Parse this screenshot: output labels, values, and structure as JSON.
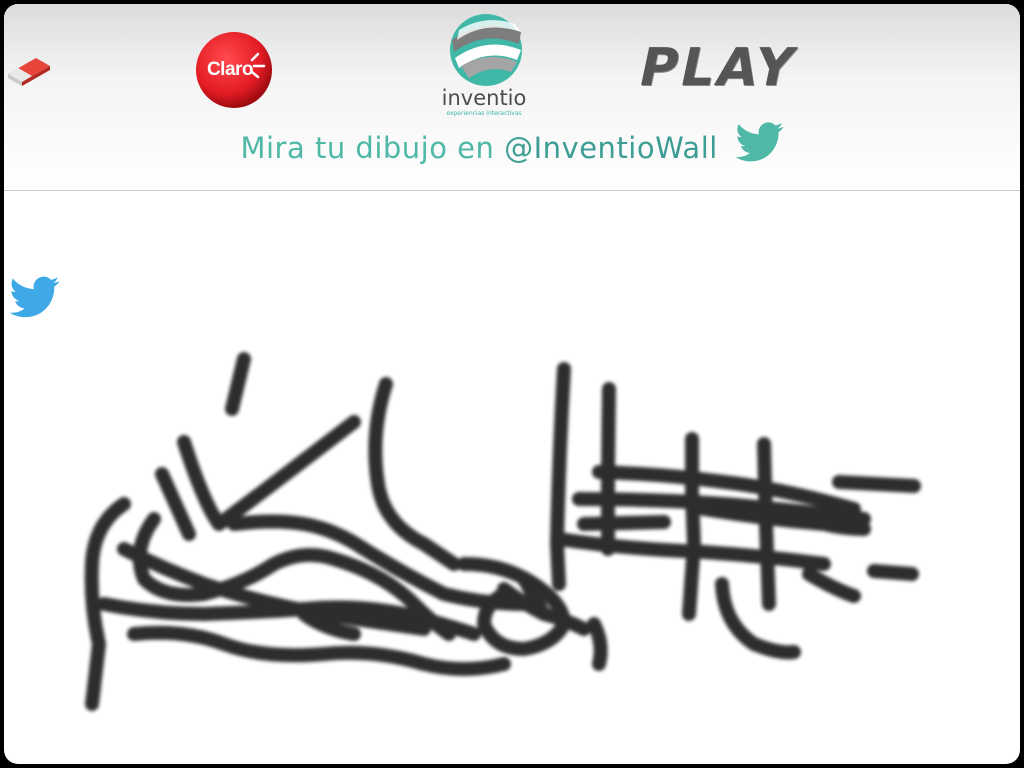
{
  "toolbar": {
    "eraser_icon": "eraser-icon"
  },
  "sponsors": {
    "claro": {
      "label": "Claro",
      "color": "#e31c24"
    },
    "inventio": {
      "word": "inventio",
      "sub": "experiencias interactivas",
      "colors": [
        "#3fb8a8",
        "#7d7d7d"
      ]
    },
    "play": {
      "label": "PLAY",
      "color": "#555555"
    }
  },
  "tagline": {
    "prefix": "Mira tu dibujo en ",
    "handle": "@InventioWall",
    "icon": "twitter-bird-icon",
    "color": "#4fb8a7"
  },
  "share": {
    "icon": "twitter-bird-icon",
    "color": "#3fa9e8"
  },
  "canvas": {
    "stroke_color": "#1a1a1a",
    "background": "#ffffff"
  }
}
